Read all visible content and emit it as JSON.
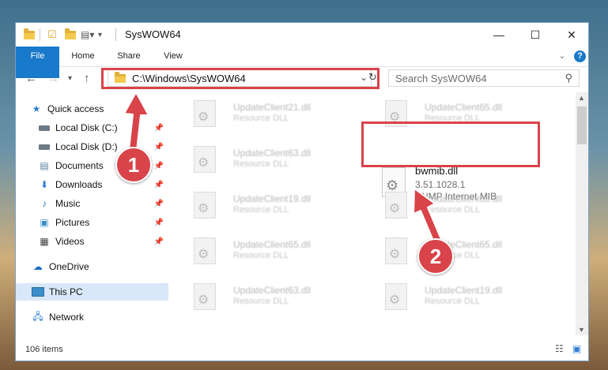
{
  "window": {
    "title": "SysWOW64",
    "minimize": "—",
    "maximize": "☐",
    "close": "✕"
  },
  "ribbon": {
    "tabs": [
      "File",
      "Home",
      "Share",
      "View"
    ],
    "expand": "⌄",
    "help": "?"
  },
  "address": {
    "path": "C:\\Windows\\SysWOW64",
    "dropdown": "⌄",
    "refresh": "↻"
  },
  "search": {
    "placeholder": "Search SysWOW64",
    "icon": "search-icon"
  },
  "nav": {
    "items": [
      {
        "label": "Quick access",
        "icon": "star-icon",
        "pinned": false
      },
      {
        "label": "Local Disk (C:)",
        "icon": "drive-icon",
        "pinned": true
      },
      {
        "label": "Local Disk (D:)",
        "icon": "drive-icon",
        "pinned": true
      },
      {
        "label": "Documents",
        "icon": "documents-icon",
        "pinned": true
      },
      {
        "label": "Downloads",
        "icon": "download-icon",
        "pinned": true
      },
      {
        "label": "Music",
        "icon": "music-icon",
        "pinned": true
      },
      {
        "label": "Pictures",
        "icon": "pictures-icon",
        "pinned": true
      },
      {
        "label": "Videos",
        "icon": "videos-icon",
        "pinned": true
      },
      {
        "label": "OneDrive",
        "icon": "cloud-icon",
        "pinned": false
      },
      {
        "label": "This PC",
        "icon": "pc-icon",
        "pinned": false
      },
      {
        "label": "Network",
        "icon": "network-icon",
        "pinned": false
      }
    ]
  },
  "files": [
    {
      "name": "UpdateClient21.dll",
      "desc": "Resource DLL"
    },
    {
      "name": "UpdateClient65.dll",
      "desc": "Resource DLL"
    },
    {
      "name": "UpdateClient63.dll",
      "desc": "Resource DLL"
    },
    {
      "name": "UpdateClient19.dll",
      "desc": "Resource DLL"
    },
    {
      "name": "UpdateClient65.dll",
      "desc": "Resource DLL"
    },
    {
      "name": "UpdateClient65.dll",
      "desc": "Resource DLL"
    },
    {
      "name": "UpdateClient65.dll",
      "desc": "Resource DLL"
    },
    {
      "name": "UpdateClient65.dll",
      "desc": "Resource DLL"
    },
    {
      "name": "UpdateClient63.dll",
      "desc": "Resource DLL"
    },
    {
      "name": "UpdateClient19.dll",
      "desc": "Resource DLL"
    }
  ],
  "highlight_file": {
    "name": "bwmib.dll",
    "version": "3.51.1028.1",
    "desc": "SNMP Internet MIB"
  },
  "status": {
    "count": "106 items"
  },
  "annotations": {
    "step1": "1",
    "step2": "2",
    "color": "#d9434a"
  }
}
